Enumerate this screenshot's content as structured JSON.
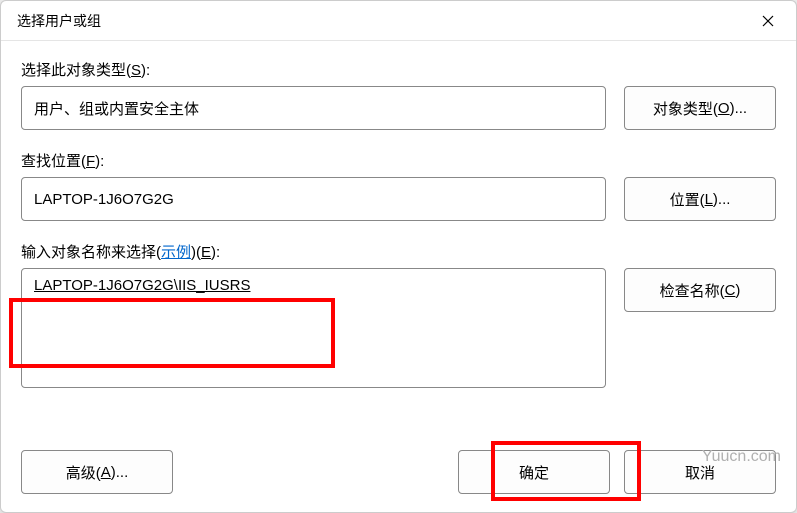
{
  "dialog": {
    "title": "选择用户或组",
    "object_type_label_pre": "选择此对象类型(",
    "object_type_label_key": "S",
    "object_type_label_post": "):",
    "object_type_value": "用户、组或内置安全主体",
    "object_types_btn_pre": "对象类型(",
    "object_types_btn_key": "O",
    "object_types_btn_post": ")...",
    "location_label_pre": "查找位置(",
    "location_label_key": "F",
    "location_label_post": "):",
    "location_value": "LAPTOP-1J6O7G2G",
    "location_btn_pre": "位置(",
    "location_btn_key": "L",
    "location_btn_post": ")...",
    "enter_names_pre": "输入对象名称来选择(",
    "enter_names_link": "示例",
    "enter_names_post_paren": ")(",
    "enter_names_key": "E",
    "enter_names_end": "):",
    "entered_name": "LAPTOP-1J6O7G2G\\IIS_IUSRS",
    "check_names_btn_pre": "检查名称(",
    "check_names_btn_key": "C",
    "check_names_btn_post": ")",
    "advanced_btn_pre": "高级(",
    "advanced_btn_key": "A",
    "advanced_btn_post": ")...",
    "ok_btn": "确定",
    "cancel_btn": "取消"
  },
  "watermark": "Yuucn.com"
}
